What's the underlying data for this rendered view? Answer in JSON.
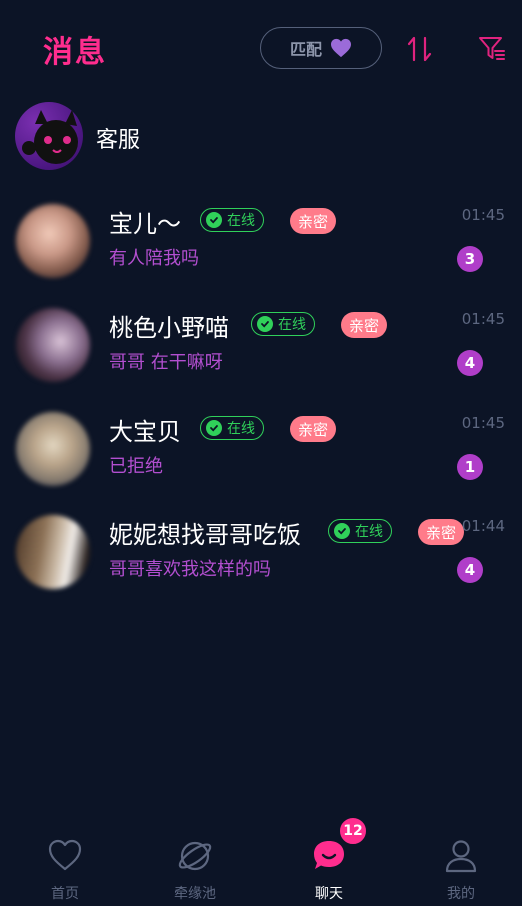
{
  "header": {
    "title": "消息",
    "match_label": "匹配",
    "icons": [
      "heart-icon",
      "sort-icon",
      "filter-icon"
    ]
  },
  "service": {
    "name": "客服"
  },
  "conversations": [
    {
      "name": "宝儿～",
      "online_label": "在线",
      "tag": "亲密",
      "time": "01:45",
      "preview": "有人陪我吗",
      "unread": "3"
    },
    {
      "name": "桃色小野喵",
      "online_label": "在线",
      "tag": "亲密",
      "time": "01:45",
      "preview": "哥哥 在干嘛呀",
      "unread": "4"
    },
    {
      "name": "大宝贝",
      "online_label": "在线",
      "tag": "亲密",
      "time": "01:45",
      "preview": "已拒绝",
      "unread": "1"
    },
    {
      "name": "妮妮想找哥哥吃饭",
      "online_label": "在线",
      "tag": "亲密",
      "time": "01:44",
      "preview": "哥哥喜欢我这样的吗",
      "unread": "4"
    }
  ],
  "tabbar": {
    "tabs": [
      {
        "label": "首页",
        "icon": "heart-outline-icon"
      },
      {
        "label": "牵缘池",
        "icon": "planet-icon"
      },
      {
        "label": "聊天",
        "icon": "chat-bubble-icon",
        "active": true
      },
      {
        "label": "我的",
        "icon": "person-icon"
      }
    ],
    "chat_badge": "12"
  },
  "colors": {
    "background": "#0c1426",
    "accent_pink": "#ff2d8e",
    "online_green": "#30d05a",
    "intimate_tag": "#ff7b8a",
    "preview_purple": "#b34fd0",
    "badge_purple": "#b03ec9",
    "muted": "#5d6780"
  }
}
